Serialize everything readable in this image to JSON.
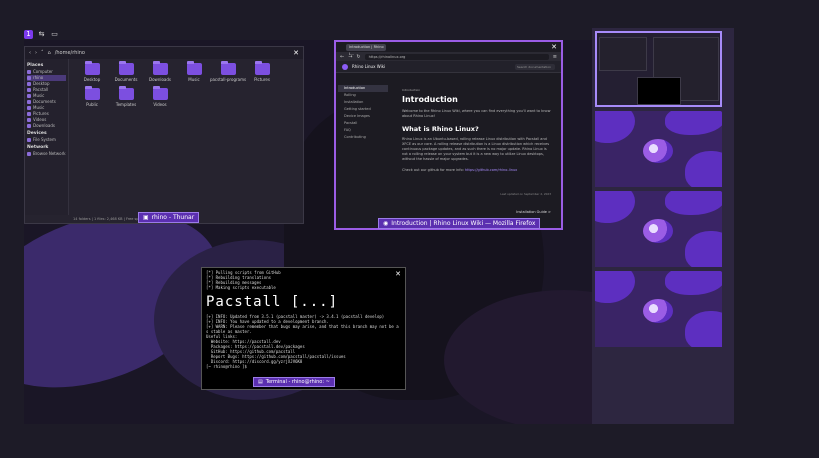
{
  "topbar": {
    "icons": [
      "workspace-1-icon",
      "tile-icon",
      "window-icon"
    ]
  },
  "thunar": {
    "path": "/home/rhino",
    "taskbar_label": "rhino - Thunar",
    "status": "14 folders  |  1 files: 2,468 KB  |  Free space: 5.1 GB",
    "sidebar": {
      "places_header": "Places",
      "places": [
        "Computer",
        "rhino",
        "Desktop",
        "Pacstall",
        "Music",
        "Documents",
        "Music",
        "Pictures",
        "Videos",
        "Downloads"
      ],
      "devices_header": "Devices",
      "devices": [
        "File System"
      ],
      "network_header": "Network",
      "network": [
        "Browse Network"
      ]
    },
    "folders": [
      "Desktop",
      "Documents",
      "Downloads",
      "Music",
      "pacstall-programs",
      "Pictures",
      "Public",
      "Templates",
      "Videos"
    ]
  },
  "firefox": {
    "tab_title": "Introduction | Rhino L...",
    "url": "https://rhinolinux.org",
    "taskbar_label": "Introduction | Rhino Linux Wiki — Mozilla Firefox",
    "wiki": {
      "brand": "Rhino Linux Wiki",
      "search_placeholder": "Search documentation",
      "nav": [
        "Introduction",
        "Rolling",
        "Installation",
        "Getting started",
        "Device Images",
        "Pacstall",
        "FAQ",
        "Contributing"
      ],
      "breadcrumb": "Introduction",
      "h1": "Introduction",
      "intro": "Welcome to the Rhino Linux Wiki, where you can find everything you'll want to know about Rhino Linux!",
      "h2": "What is Rhino Linux?",
      "body": "Rhino Linux is an Ubuntu-based, rolling release Linux distribution with Pacstall and XFCE as our core. A rolling release distribution is a Linux distribution which receives continuous package updates, and as such there is no major update. Rhino Linux is not a rolling release on your system but it is a new way to utilize Linux desktops, without the hassle of major upgrades.",
      "github_text": "Check out our github for more info:",
      "github_link": "https://github.com/rhino-linux",
      "last_updated": "Last updated on September 2, 2023",
      "next": "Installation Guide >"
    }
  },
  "terminal": {
    "pre_lines": [
      "[*] Pulling scripts from GitHub",
      "[*] Rebuilding translations",
      "[*] Rebuilding messages",
      "[*] Making scripts executable"
    ],
    "ascii_art": "Pacstall [...]",
    "lines": [
      "[+] INFO: Updated from 3.5.1 (pacstall master) -> 3.4.1 (pacstall develop)",
      "[+] INFO: You have updated to a development branch.",
      "[+] WARN: Please remember that bugs may arise, and that this branch may not be a",
      "s stable as master.",
      "Useful links:",
      "  Website: https://pacstall.dev",
      "  Packages: https://pacstall.dev/packages",
      "  GitHub: https://github.com/pacstall",
      "  Report Bugs: https://github.com/pacstall/pacstall/issues",
      "  Discord: https://discord.gg/yzrjXJV6K8"
    ],
    "prompt": "[~ rhino@rhino ]$",
    "taskbar_label": "Terminal - rhino@rhino: ~"
  },
  "workspaces": {
    "count": 4,
    "current": 1
  }
}
